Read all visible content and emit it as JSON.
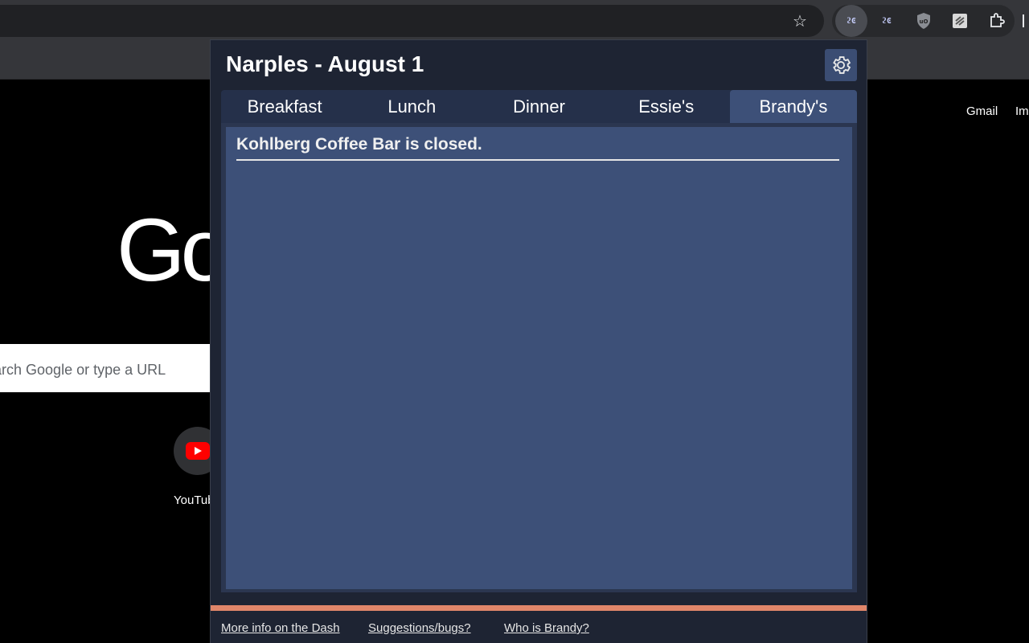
{
  "browser": {
    "star_icon": "star-icon",
    "extensions": [
      "narples-extension-icon",
      "narples-extension-icon-2",
      "ublock-icon",
      "bookmark-extension-icon",
      "puzzle-icon"
    ]
  },
  "page": {
    "gmail": "Gmail",
    "images": "Images",
    "logo": "Google",
    "search_placeholder": "Search Google or type a URL",
    "shortcut_label": "YouTube"
  },
  "popup": {
    "title": "Narples - August 1",
    "tabs": [
      {
        "label": "Breakfast"
      },
      {
        "label": "Lunch"
      },
      {
        "label": "Dinner"
      },
      {
        "label": "Essie's"
      },
      {
        "label": "Brandy's"
      }
    ],
    "active_tab": "Brandy's",
    "status": "Kohlberg Coffee Bar is closed.",
    "footer_links": [
      {
        "label": "More info on the Dash"
      },
      {
        "label": "Suggestions/bugs?"
      },
      {
        "label": "Who is Brandy?"
      }
    ]
  },
  "colors": {
    "popup_bg": "#1e2433",
    "tab_active": "#3d5078",
    "accent": "#e0866a"
  }
}
